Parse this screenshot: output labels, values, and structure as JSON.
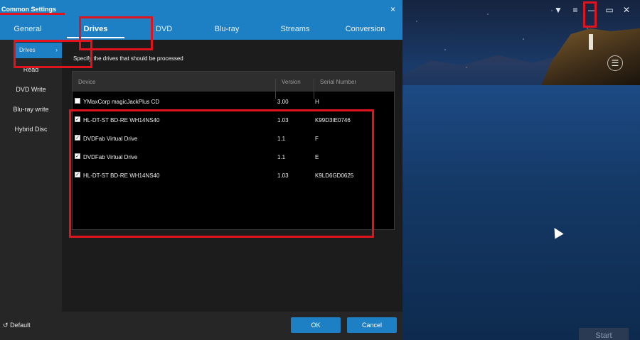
{
  "dialog": {
    "title": "Common Settings",
    "close_glyph": "×",
    "tabs": [
      {
        "label": "General"
      },
      {
        "label": "Drives"
      },
      {
        "label": "DVD"
      },
      {
        "label": "Blu-ray"
      },
      {
        "label": "Streams"
      },
      {
        "label": "Conversion"
      }
    ],
    "sidebar": [
      {
        "label": "Drives"
      },
      {
        "label": "Read"
      },
      {
        "label": "DVD Write"
      },
      {
        "label": "Blu-ray write"
      },
      {
        "label": "Hybrid Disc"
      }
    ],
    "instruction": "Specify the drives that should be processed",
    "table": {
      "headers": {
        "device": "Device",
        "version": "Version",
        "serial": "Serial Number"
      },
      "rows": [
        {
          "device": "YMaxCorp magicJackPlus CD",
          "version": "3.00",
          "serial": "H",
          "checked": false
        },
        {
          "device": "HL-DT-ST BD-RE  WH14NS40",
          "version": "1.03",
          "serial": "K99D3IE0746",
          "checked": true
        },
        {
          "device": "DVDFab Virtual Drive",
          "version": "1.1",
          "serial": "F",
          "checked": true
        },
        {
          "device": "DVDFab Virtual Drive",
          "version": "1.1",
          "serial": "E",
          "checked": true
        },
        {
          "device": "HL-DT-ST BD-RE  WH14NS40",
          "version": "1.03",
          "serial": "K9LD6GD0625",
          "checked": true
        }
      ]
    },
    "footer": {
      "default_label": "Default",
      "ok_label": "OK",
      "cancel_label": "Cancel"
    }
  },
  "background_app": {
    "start_label": "Start"
  },
  "colors": {
    "accent": "#1d7fc4",
    "highlight": "#e0141e"
  }
}
